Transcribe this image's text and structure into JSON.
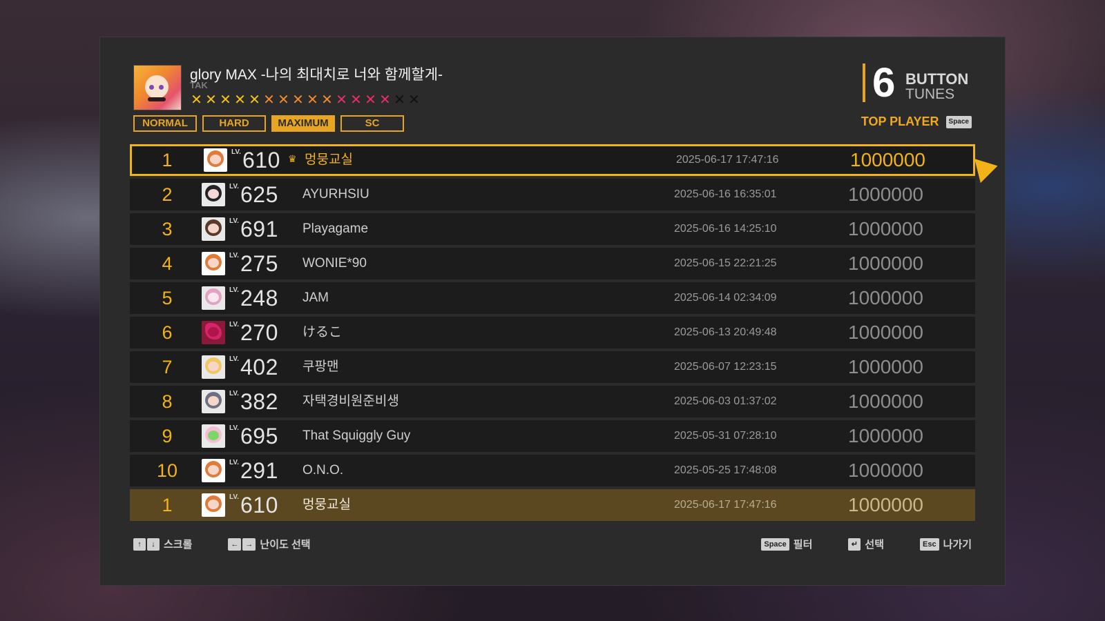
{
  "song": {
    "title": "glory MAX -나의 최대치로 너와 함께할게-",
    "artist": "TAK",
    "stars": [
      {
        "glyph": "✕",
        "color": "#f5c21b"
      },
      {
        "glyph": "✕",
        "color": "#f5c21b"
      },
      {
        "glyph": "✕",
        "color": "#f5c21b"
      },
      {
        "glyph": "✕",
        "color": "#f5c21b"
      },
      {
        "glyph": "✕",
        "color": "#f5c21b"
      },
      {
        "glyph": "✕",
        "color": "#f08a2c"
      },
      {
        "glyph": "✕",
        "color": "#f08a2c"
      },
      {
        "glyph": "✕",
        "color": "#f08a2c"
      },
      {
        "glyph": "✕",
        "color": "#f08a2c"
      },
      {
        "glyph": "✕",
        "color": "#f08a2c"
      },
      {
        "glyph": "✕",
        "color": "#ea2f64"
      },
      {
        "glyph": "✕",
        "color": "#ea2f64"
      },
      {
        "glyph": "✕",
        "color": "#ea2f64"
      },
      {
        "glyph": "✕",
        "color": "#ea2f64"
      },
      {
        "glyph": "✕",
        "color": "#111111"
      },
      {
        "glyph": "✕",
        "color": "#111111"
      }
    ]
  },
  "difficulties": [
    {
      "label": "NORMAL",
      "active": false
    },
    {
      "label": "HARD",
      "active": false
    },
    {
      "label": "MAXIMUM",
      "active": true
    },
    {
      "label": "SC",
      "active": false
    }
  ],
  "brand": {
    "number": "6",
    "line1": "BUTTON",
    "line2": "TUNES"
  },
  "top_player": {
    "label": "TOP PLAYER",
    "key": "Space"
  },
  "lv_prefix": "LV.",
  "rankings": [
    {
      "rank": "1",
      "avatar": "astro",
      "level": "610",
      "crown": true,
      "name": "멍뭉교실",
      "date": "2025-06-17 17:47:16",
      "score": "1000000",
      "selected": true
    },
    {
      "rank": "2",
      "avatar": "dark",
      "level": "625",
      "crown": false,
      "name": "AYURHSIU",
      "date": "2025-06-16 16:35:01",
      "score": "1000000",
      "selected": false
    },
    {
      "rank": "3",
      "avatar": "brown",
      "level": "691",
      "crown": false,
      "name": "Playagame",
      "date": "2025-06-16 14:25:10",
      "score": "1000000",
      "selected": false
    },
    {
      "rank": "4",
      "avatar": "astro",
      "level": "275",
      "crown": false,
      "name": "WONIE*90",
      "date": "2025-06-15 22:21:25",
      "score": "1000000",
      "selected": false
    },
    {
      "rank": "5",
      "avatar": "pink",
      "level": "248",
      "crown": false,
      "name": "JAM",
      "date": "2025-06-14 02:34:09",
      "score": "1000000",
      "selected": false
    },
    {
      "rank": "6",
      "avatar": "red",
      "level": "270",
      "crown": false,
      "name": "けるこ",
      "date": "2025-06-13 20:49:48",
      "score": "1000000",
      "selected": false
    },
    {
      "rank": "7",
      "avatar": "blond",
      "level": "402",
      "crown": false,
      "name": "쿠팡맨",
      "date": "2025-06-07 12:23:15",
      "score": "1000000",
      "selected": false
    },
    {
      "rank": "8",
      "avatar": "gray",
      "level": "382",
      "crown": false,
      "name": "자택경비원준비생",
      "date": "2025-06-03 01:37:02",
      "score": "1000000",
      "selected": false
    },
    {
      "rank": "9",
      "avatar": "green",
      "level": "695",
      "crown": false,
      "name": "That Squiggly Guy",
      "date": "2025-05-31 07:28:10",
      "score": "1000000",
      "selected": false
    },
    {
      "rank": "10",
      "avatar": "astro",
      "level": "291",
      "crown": false,
      "name": "O.N.O.",
      "date": "2025-05-25 17:48:08",
      "score": "1000000",
      "selected": false
    }
  ],
  "my_record": {
    "rank": "1",
    "avatar": "astro",
    "level": "610",
    "name": "멍뭉교실",
    "date": "2025-06-17 17:47:16",
    "score": "1000000"
  },
  "footer": {
    "scroll": {
      "keys": [
        "↑",
        "↓"
      ],
      "label": "스크롤"
    },
    "difficulty": {
      "keys": [
        "←",
        "→"
      ],
      "label": "난이도 선택"
    },
    "filter": {
      "keys": [
        "Space"
      ],
      "label": "필터"
    },
    "select": {
      "keys": [
        "↵"
      ],
      "label": "선택"
    },
    "exit": {
      "keys": [
        "Esc"
      ],
      "label": "나가기"
    }
  },
  "colors": {
    "accent": "#f2b319",
    "panel": "#2b2b2b",
    "row": "#1c1c1c",
    "my_row": "#5b4820"
  }
}
